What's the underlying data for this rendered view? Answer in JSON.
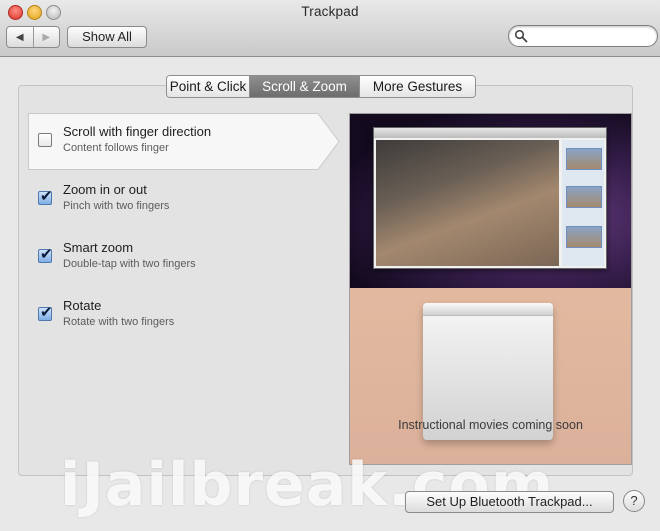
{
  "window": {
    "title": "Trackpad"
  },
  "toolbar": {
    "back_icon": "◀",
    "forward_icon": "▶",
    "show_all_label": "Show All",
    "search": {
      "value": "",
      "placeholder": ""
    }
  },
  "tabs": [
    {
      "label": "Point & Click",
      "active": false
    },
    {
      "label": "Scroll & Zoom",
      "active": true
    },
    {
      "label": "More Gestures",
      "active": false
    }
  ],
  "options": [
    {
      "title": "Scroll with finger direction",
      "subtitle": "Content follows finger",
      "checked": false,
      "selected": true
    },
    {
      "title": "Zoom in or out",
      "subtitle": "Pinch with two fingers",
      "checked": true,
      "selected": false
    },
    {
      "title": "Smart zoom",
      "subtitle": "Double-tap with two fingers",
      "checked": true,
      "selected": false
    },
    {
      "title": "Rotate",
      "subtitle": "Rotate with two fingers",
      "checked": true,
      "selected": false
    }
  ],
  "preview": {
    "caption": "Instructional movies coming soon"
  },
  "footer": {
    "setup_label": "Set Up Bluetooth Trackpad...",
    "help_label": "?"
  },
  "watermark": "iJailbreak.com",
  "check_glyph": "✔",
  "colors": {
    "active_tab": "#7a7a7a",
    "checkbox_checked": "#7faee6"
  }
}
